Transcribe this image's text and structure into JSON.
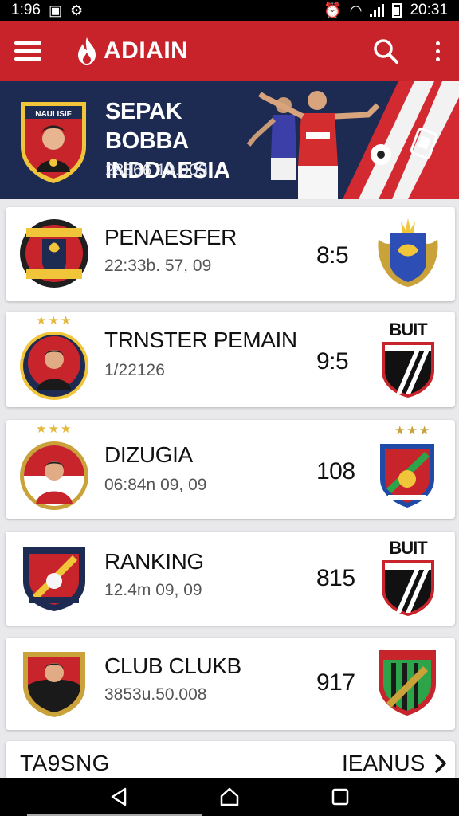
{
  "status_bar": {
    "time_left": "1:96",
    "time_right": "20:31"
  },
  "app": {
    "title": "ADIAIN"
  },
  "hero": {
    "title_line1": "SEPAK BOBBA",
    "title_line2": "INDDAESIA",
    "subtitle": "28866 19.909",
    "badge_text": "NAUI  ISIF"
  },
  "items": [
    {
      "title": "PENAESFER",
      "subtitle": "22:33b. 57, 09",
      "score": "8:5",
      "tag": ""
    },
    {
      "title": "TRNSTER PEMAIN",
      "subtitle": "1/22126",
      "score": "9:5",
      "tag": "BUIT"
    },
    {
      "title": "DIZUGIA",
      "subtitle": "06:84n 09, 09",
      "score": "108",
      "tag": ""
    },
    {
      "title": "RANKING",
      "subtitle": "12.4m 09, 09",
      "score": "815",
      "tag": "BUIT"
    },
    {
      "title": "CLUB CLUKB",
      "subtitle": "3853u.50.008",
      "score": "917",
      "tag": ""
    }
  ],
  "footer": {
    "left_label": "TA9SNG",
    "right_label": "IEANUS"
  },
  "colors": {
    "primary_red": "#c8232a",
    "hero_navy": "#1d2a52",
    "background": "#e9e9ec"
  },
  "icons": [
    "menu-icon",
    "flame-icon",
    "search-icon",
    "more-vert-icon",
    "chevron-right-icon",
    "back-icon",
    "home-icon",
    "recents-icon"
  ]
}
